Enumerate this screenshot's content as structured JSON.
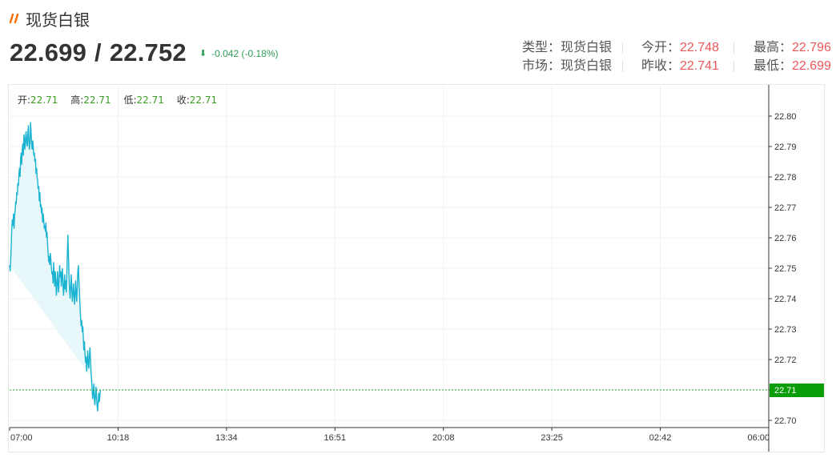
{
  "header": {
    "title": "现货白银",
    "icon": "double-slash-icon",
    "accent": "#ff6a00"
  },
  "quote": {
    "bid": "22.699",
    "separator": "/",
    "ask": "22.752",
    "change": "-0.042 (-0.18%)",
    "direction_icon": "down-arrow-icon"
  },
  "info": {
    "type_label": "类型：",
    "type_value": "现货白银",
    "market_label": "市场：",
    "market_value": "现货白银",
    "open_label": "今开：",
    "open_value": "22.748",
    "prev_close_label": "昨收：",
    "prev_close_value": "22.741",
    "high_label": "最高：",
    "high_value": "22.796",
    "low_label": "最低：",
    "low_value": "22.699"
  },
  "ohlc": {
    "open_label": "开:",
    "open": "22.71",
    "high_label": "高:",
    "high": "22.71",
    "low_label": "低:",
    "low": "22.71",
    "close_label": "收:",
    "close": "22.71"
  },
  "chart_data": {
    "type": "area",
    "x_ticks": [
      "07:00",
      "10:18",
      "13:34",
      "16:51",
      "20:08",
      "23:25",
      "02:42",
      "06:00"
    ],
    "y_ticks": [
      "22.80",
      "22.79",
      "22.78",
      "22.77",
      "22.76",
      "22.75",
      "22.74",
      "22.73",
      "22.72",
      "22.71",
      "22.70"
    ],
    "ylim": [
      22.7,
      22.8
    ],
    "current_price": 22.71,
    "current_price_label": "22.71",
    "line_color": "#1ab3d1",
    "fill_color": "#e8f7f9",
    "price_line_color": "#2ea52e",
    "series": [
      {
        "x_minutes": [
          0,
          1,
          2,
          3,
          4,
          5,
          6,
          7,
          8,
          9,
          10,
          11,
          12,
          13,
          14,
          15,
          16,
          17,
          18,
          19,
          20,
          21,
          22,
          23,
          24,
          25,
          26,
          27,
          28,
          29,
          30,
          31,
          32,
          33,
          34,
          35,
          36,
          37,
          38,
          39,
          40,
          41,
          42,
          43,
          44,
          45,
          46,
          47,
          48,
          49,
          50,
          51,
          52,
          53,
          54,
          55,
          56,
          57,
          58,
          59,
          60,
          61,
          62,
          63,
          64,
          65,
          66,
          67,
          68,
          69,
          70,
          71,
          72,
          73,
          74,
          75,
          76,
          77,
          78,
          79,
          80,
          81,
          82,
          83,
          84,
          85,
          86,
          87,
          88,
          89,
          90,
          91,
          92,
          93,
          94,
          95,
          96,
          97,
          98,
          99,
          100,
          101,
          102,
          103,
          104,
          105,
          106,
          107,
          108,
          109,
          110,
          111,
          112,
          113,
          114,
          115,
          116,
          117,
          118,
          119,
          120,
          121,
          122,
          123,
          124,
          125,
          126,
          127,
          128,
          129,
          130,
          131,
          132,
          133,
          134,
          135,
          136,
          137,
          138,
          139,
          140,
          141,
          142,
          143,
          144,
          145,
          146,
          147,
          148,
          149,
          150,
          151,
          152,
          153,
          154,
          155,
          156,
          157,
          158,
          159,
          160,
          161,
          162,
          163,
          164,
          165,
          166,
          167,
          168,
          169,
          170,
          171,
          172,
          173,
          174,
          175,
          176,
          177,
          178,
          179,
          180,
          181,
          182,
          183,
          184,
          185,
          186,
          187,
          188,
          189,
          190,
          191,
          192,
          193,
          194,
          195,
          196,
          197,
          198,
          199,
          200,
          201,
          202,
          203,
          204,
          205,
          206,
          207,
          208,
          209,
          210,
          211,
          212,
          213,
          214,
          215,
          216,
          217,
          218,
          219,
          220,
          221,
          222,
          223,
          224,
          225,
          226,
          227,
          228,
          229,
          230,
          231,
          232,
          233,
          234,
          235,
          236,
          237,
          238,
          239
        ],
        "values": [
          22.751,
          22.749,
          22.753,
          22.758,
          22.763,
          22.766,
          22.764,
          22.768,
          22.763,
          22.767,
          22.769,
          22.772,
          22.771,
          22.775,
          22.774,
          22.778,
          22.777,
          22.781,
          22.783,
          22.78,
          22.786,
          22.788,
          22.784,
          22.789,
          22.791,
          22.787,
          22.794,
          22.792,
          22.789,
          22.793,
          22.795,
          22.791,
          22.79,
          22.794,
          22.797,
          22.792,
          22.789,
          22.791,
          22.798,
          22.795,
          22.791,
          22.789,
          22.792,
          22.79,
          22.787,
          22.788,
          22.785,
          22.786,
          22.781,
          22.783,
          22.78,
          22.779,
          22.776,
          22.777,
          22.772,
          22.775,
          22.77,
          22.771,
          22.768,
          22.77,
          22.765,
          22.768,
          22.766,
          22.763,
          22.764,
          22.762,
          22.765,
          22.76,
          22.762,
          22.758,
          22.755,
          22.752,
          22.754,
          22.751,
          22.755,
          22.753,
          22.75,
          22.748,
          22.749,
          22.745,
          22.752,
          22.748,
          22.744,
          22.749,
          22.746,
          22.741,
          22.744,
          22.749,
          22.745,
          22.742,
          22.746,
          22.751,
          22.747,
          22.749,
          22.744,
          22.748,
          22.75,
          22.745,
          22.741,
          22.744,
          22.748,
          22.743,
          22.746,
          22.742,
          22.747,
          22.755,
          22.761,
          22.754,
          22.747,
          22.743,
          22.74,
          22.744,
          22.748,
          22.744,
          22.739,
          22.741,
          22.745,
          22.742,
          22.738,
          22.741,
          22.746,
          22.742,
          22.739,
          22.744,
          22.749,
          22.751,
          22.746,
          22.742,
          22.738,
          22.734,
          22.731,
          22.733,
          22.729,
          22.731,
          22.727,
          22.723,
          22.726,
          22.722,
          22.719,
          22.721,
          22.716,
          22.719,
          22.723,
          22.719,
          22.717,
          22.721,
          22.724,
          22.72,
          22.716,
          22.713,
          22.71,
          22.707,
          22.709,
          22.712,
          22.707,
          22.705,
          22.708,
          22.711,
          22.708,
          22.705,
          22.703,
          22.706,
          22.709,
          22.706,
          22.708,
          22.71
        ]
      }
    ]
  }
}
